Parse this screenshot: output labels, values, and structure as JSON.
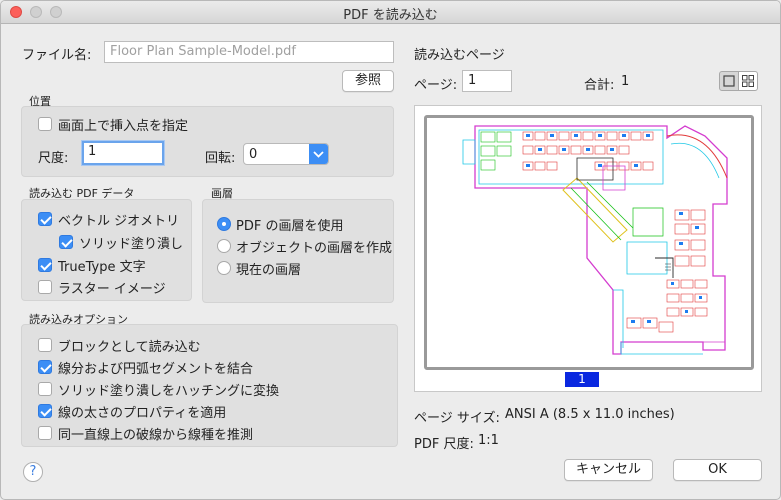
{
  "window": {
    "title": "PDF を読み込む"
  },
  "file": {
    "label": "ファイル名:",
    "placeholder": "Floor Plan Sample-Model.pdf",
    "browse_label": "参照"
  },
  "position": {
    "title": "位置",
    "specify_on_screen": {
      "label": "画面上で挿入点を指定",
      "checked": false
    },
    "scale_label": "尺度:",
    "scale_value": "1",
    "rotation_label": "回転:",
    "rotation_value": "0"
  },
  "pdf_data": {
    "title": "読み込む PDF データ",
    "items": [
      {
        "label": "ベクトル ジオメトリ",
        "checked": true
      },
      {
        "label": "ソリッド塗り潰し",
        "checked": true
      },
      {
        "label": "TrueType 文字",
        "checked": true
      },
      {
        "label": "ラスター イメージ",
        "checked": false
      }
    ]
  },
  "layers": {
    "title": "画層",
    "options": [
      {
        "label": "PDF の画層を使用",
        "selected": true
      },
      {
        "label": "オブジェクトの画層を作成",
        "selected": false
      },
      {
        "label": "現在の画層",
        "selected": false
      }
    ]
  },
  "import_options": {
    "title": "読み込みオプション",
    "items": [
      {
        "label": "ブロックとして読み込む",
        "checked": false
      },
      {
        "label": "線分および円弧セグメントを結合",
        "checked": true
      },
      {
        "label": "ソリッド塗り潰しをハッチングに変換",
        "checked": false
      },
      {
        "label": "線の太さのプロパティを適用",
        "checked": true
      },
      {
        "label": "同一直線上の破線から線種を推測",
        "checked": false
      }
    ]
  },
  "page": {
    "title": "読み込むページ",
    "page_label": "ページ:",
    "page_value": "1",
    "total_label": "合計:",
    "total_value": "1",
    "thumb_number": "1",
    "size_label": "ページ サイズ:",
    "size_value": "ANSI A (8.5 x 11.0 inches)",
    "scale_label": "PDF 尺度:",
    "scale_value": "1:1"
  },
  "footer": {
    "help_label": "?",
    "cancel_label": "キャンセル",
    "ok_label": "OK"
  },
  "colors": {
    "accent": "#3c8ef5",
    "page_badge": "#0a28e0",
    "close_button": "#fc605b"
  },
  "icons": {
    "close": "close-icon",
    "checkmark": "checkmark-icon",
    "chevron": "chevron-down-icon",
    "help": "help-icon",
    "single_page_view": "single-page-view-icon",
    "thumbnail_grid_view": "thumbnail-grid-view-icon"
  }
}
